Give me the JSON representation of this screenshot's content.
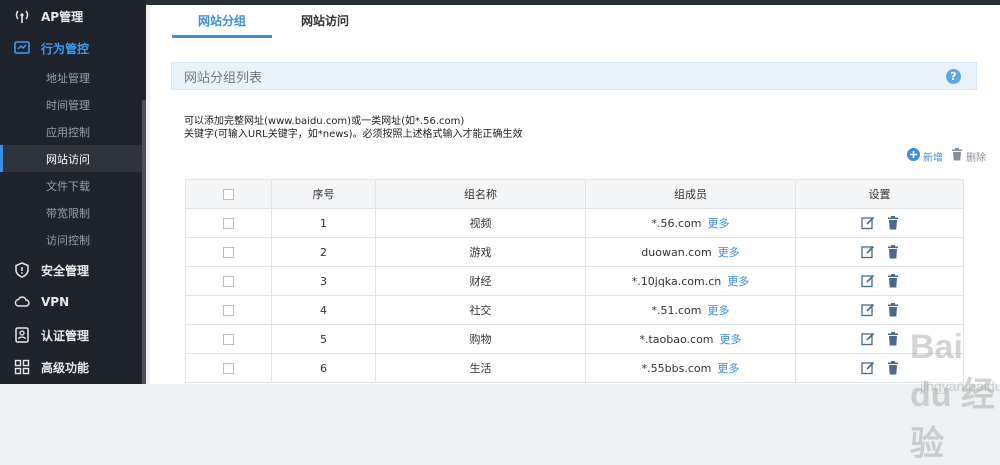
{
  "sidebar": {
    "items": [
      {
        "label": "AP管理",
        "icon": "antenna-icon"
      },
      {
        "label": "行为管控",
        "icon": "monitor-icon"
      },
      {
        "label": "安全管理",
        "icon": "shield-icon"
      },
      {
        "label": "VPN",
        "icon": "cloud-icon"
      },
      {
        "label": "认证管理",
        "icon": "id-card-icon"
      },
      {
        "label": "高级功能",
        "icon": "grid-icon"
      }
    ],
    "subitems": [
      "地址管理",
      "时间管理",
      "应用控制",
      "网站访问",
      "文件下载",
      "带宽限制",
      "访问控制"
    ],
    "active_sub": "网站访问"
  },
  "tabs": [
    {
      "label": "网站分组",
      "active": true
    },
    {
      "label": "网站访问",
      "active": false
    }
  ],
  "section": {
    "title": "网站分组列表",
    "help": "?"
  },
  "hints": [
    "可以添加完整网址(www.baidu.com)或一类网址(如*.56.com)",
    "关键字(可输入URL关键字，如*news)。必须按照上述格式输入才能正确生效"
  ],
  "toolbar": {
    "add_label": "新增",
    "delete_label": "删除"
  },
  "table": {
    "headers": [
      "序号",
      "组名称",
      "组成员",
      "设置"
    ],
    "more_label": "更多",
    "rows": [
      {
        "no": "1",
        "name": "视频",
        "member": "*.56.com"
      },
      {
        "no": "2",
        "name": "游戏",
        "member": "duowan.com"
      },
      {
        "no": "3",
        "name": "财经",
        "member": "*.10jqka.com.cn"
      },
      {
        "no": "4",
        "name": "社交",
        "member": "*.51.com"
      },
      {
        "no": "5",
        "name": "购物",
        "member": "*.taobao.com"
      },
      {
        "no": "6",
        "name": "生活",
        "member": "*.55bbs.com"
      }
    ]
  },
  "watermark": {
    "line1": "Bai du 经验",
    "line2": "jingyan.baidu.com"
  },
  "colors": {
    "accent": "#3a8ee6",
    "sidebar_bg": "#1f232b"
  }
}
